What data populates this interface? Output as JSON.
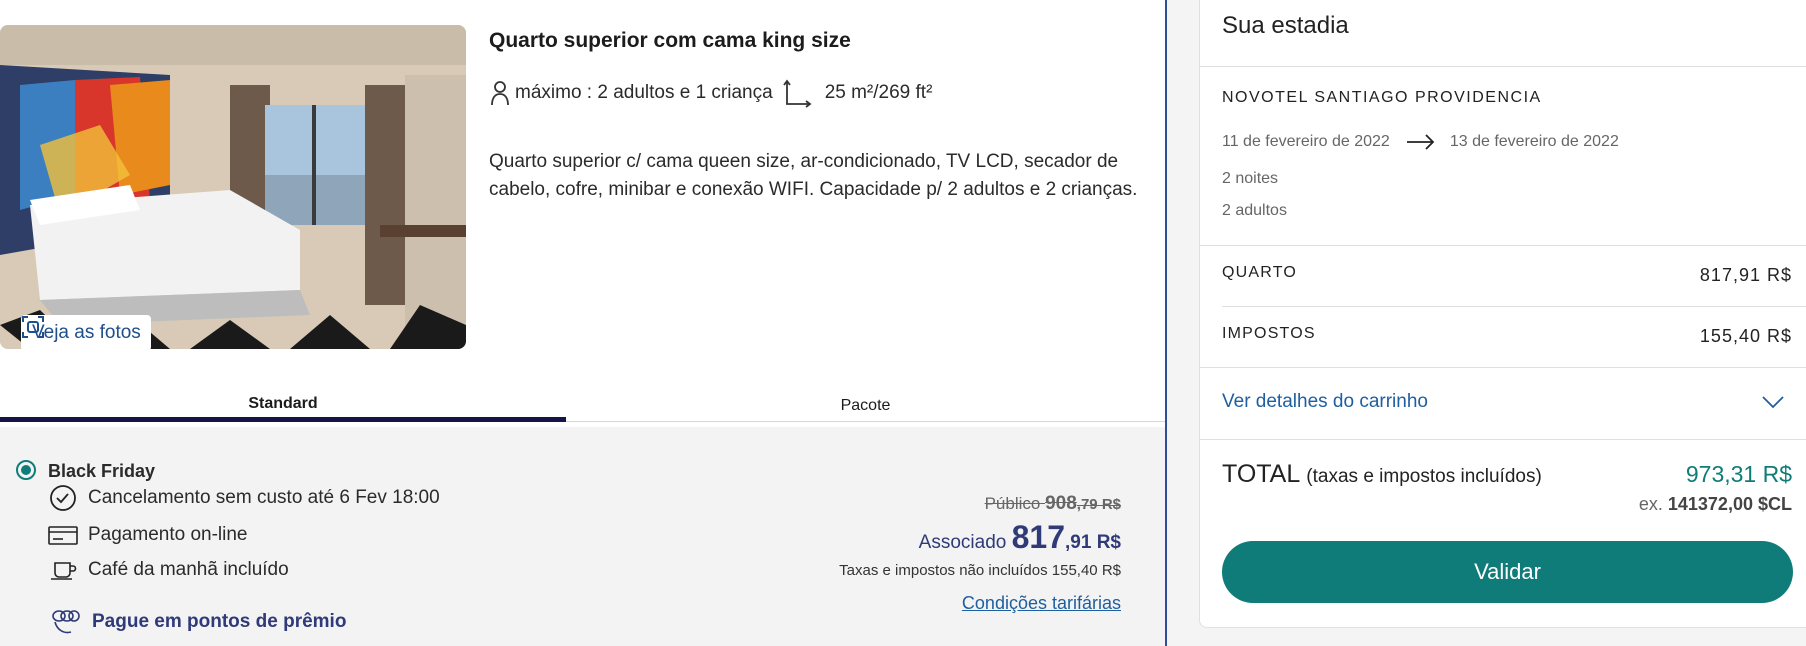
{
  "room": {
    "title": "Quarto superior com cama king size",
    "capacity": "máximo : 2 adultos e 1 criança",
    "size": "25 m²/269 ft²",
    "description": "Quarto superior c/ cama queen size, ar-condicionado, TV LCD, secador de cabelo, cofre, minibar e conexão WIFI. Capacidade p/ 2 adultos e 2 crianças.",
    "photos_button": "Veja as fotos"
  },
  "tabs": [
    {
      "label": "Standard",
      "active": true
    },
    {
      "label": "Pacote",
      "active": false
    }
  ],
  "rate": {
    "name": "Black Friday",
    "features": [
      {
        "icon": "clock-icon",
        "text": "Cancelamento sem custo até 6 Fev 18:00"
      },
      {
        "icon": "credit-card-icon",
        "text": "Pagamento on-line"
      },
      {
        "icon": "coffee-cup-icon",
        "text": "Café da manhã incluído"
      }
    ],
    "points_link": "Pague em pontos de prêmio",
    "public_label": "Público",
    "public_int": "908",
    "public_dec": ",79 R$",
    "member_label": "Associado",
    "member_int": "817",
    "member_dec": ",91 R$",
    "tax_note": "Taxas e impostos não incluídos 155,40 R$",
    "conditions_link": "Condições tarifárias"
  },
  "summary": {
    "title": "Sua estadia",
    "hotel": "NOVOTEL SANTIAGO PROVIDENCIA",
    "checkin": "11 de fevereiro de 2022",
    "checkout": "13 de fevereiro de 2022",
    "nights": "2 noites",
    "guests": "2 adultos",
    "room_label": "QUARTO",
    "room_value": "817,91 R$",
    "taxes_label": "IMPOSTOS",
    "taxes_value": "155,40 R$",
    "details_link": "Ver detalhes do carrinho",
    "total_label": "TOTAL",
    "total_sub": "(taxas e impostos incluídos)",
    "total_value": "973,31 R$",
    "alt_prefix": "ex.",
    "alt_value": "141372,00",
    "alt_currency": "$CL",
    "validate_button": "Validar"
  },
  "colors": {
    "accent": "#0f7c7a",
    "navy": "#2f3a78",
    "link": "#1f5fa0",
    "divider": "#2f4d99"
  }
}
